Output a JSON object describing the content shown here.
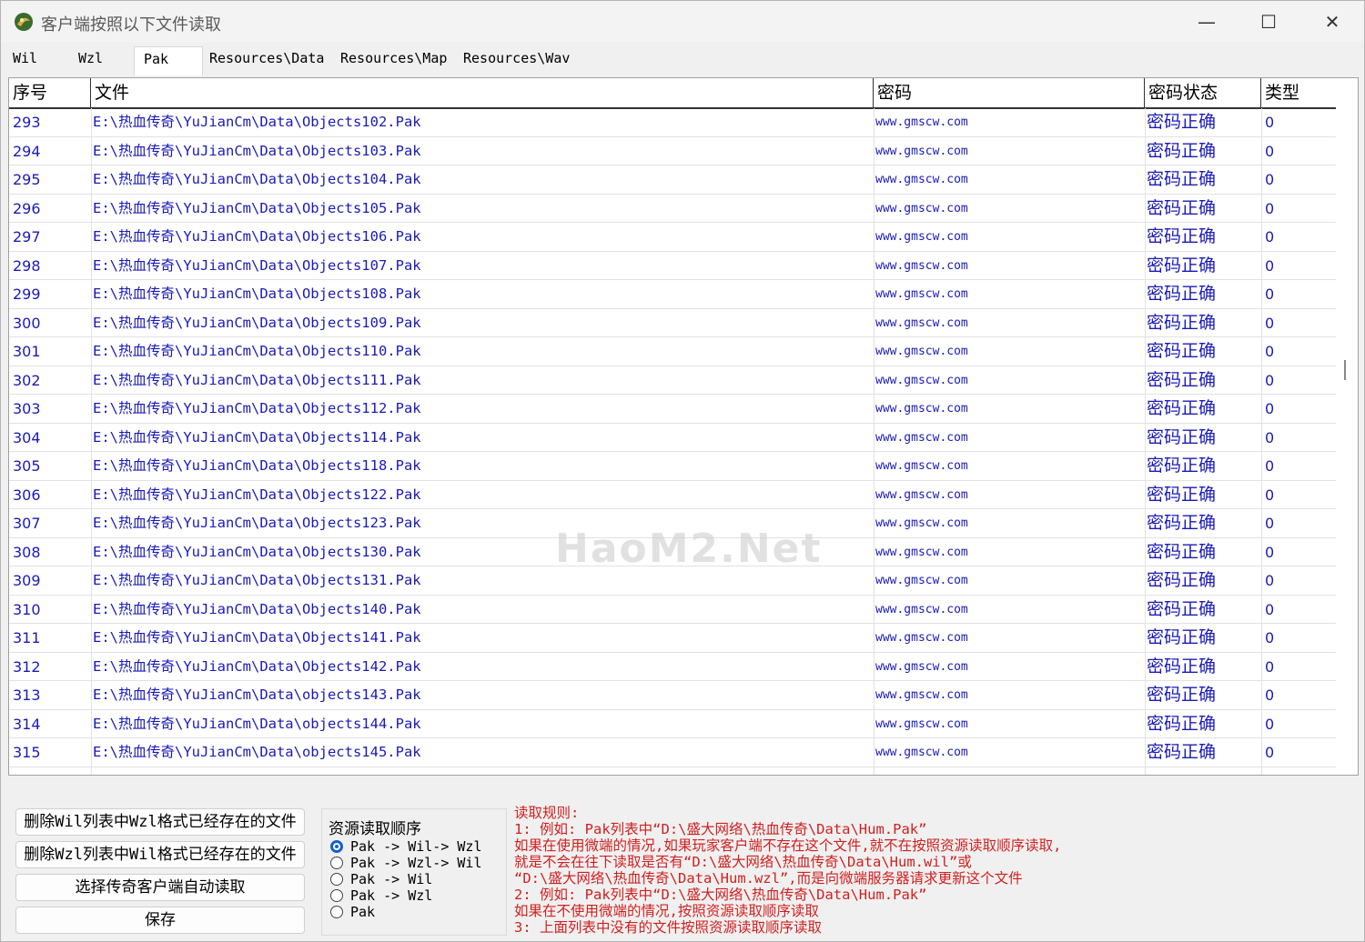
{
  "window": {
    "title": "客户端按照以下文件读取",
    "controls": {
      "minimize": "—",
      "maximize": "☐",
      "close": "✕"
    }
  },
  "tabs": [
    {
      "label": "Wil"
    },
    {
      "label": "Wzl"
    },
    {
      "label": "Pak"
    },
    {
      "label": "Resources\\Data"
    },
    {
      "label": "Resources\\Map"
    },
    {
      "label": "Resources\\Wav"
    }
  ],
  "table": {
    "columns": [
      "序号",
      "文件",
      "密码",
      "密码状态",
      "类型"
    ],
    "rows": [
      {
        "no": "293",
        "file": "E:\\热血传奇\\YuJianCm\\Data\\Objects102.Pak",
        "password": "www.gmscw.com",
        "status": "密码正确",
        "type": "0"
      },
      {
        "no": "294",
        "file": "E:\\热血传奇\\YuJianCm\\Data\\Objects103.Pak",
        "password": "www.gmscw.com",
        "status": "密码正确",
        "type": "0"
      },
      {
        "no": "295",
        "file": "E:\\热血传奇\\YuJianCm\\Data\\Objects104.Pak",
        "password": "www.gmscw.com",
        "status": "密码正确",
        "type": "0"
      },
      {
        "no": "296",
        "file": "E:\\热血传奇\\YuJianCm\\Data\\Objects105.Pak",
        "password": "www.gmscw.com",
        "status": "密码正确",
        "type": "0"
      },
      {
        "no": "297",
        "file": "E:\\热血传奇\\YuJianCm\\Data\\Objects106.Pak",
        "password": "www.gmscw.com",
        "status": "密码正确",
        "type": "0"
      },
      {
        "no": "298",
        "file": "E:\\热血传奇\\YuJianCm\\Data\\Objects107.Pak",
        "password": "www.gmscw.com",
        "status": "密码正确",
        "type": "0"
      },
      {
        "no": "299",
        "file": "E:\\热血传奇\\YuJianCm\\Data\\Objects108.Pak",
        "password": "www.gmscw.com",
        "status": "密码正确",
        "type": "0"
      },
      {
        "no": "300",
        "file": "E:\\热血传奇\\YuJianCm\\Data\\Objects109.Pak",
        "password": "www.gmscw.com",
        "status": "密码正确",
        "type": "0"
      },
      {
        "no": "301",
        "file": "E:\\热血传奇\\YuJianCm\\Data\\Objects110.Pak",
        "password": "www.gmscw.com",
        "status": "密码正确",
        "type": "0"
      },
      {
        "no": "302",
        "file": "E:\\热血传奇\\YuJianCm\\Data\\Objects111.Pak",
        "password": "www.gmscw.com",
        "status": "密码正确",
        "type": "0"
      },
      {
        "no": "303",
        "file": "E:\\热血传奇\\YuJianCm\\Data\\Objects112.Pak",
        "password": "www.gmscw.com",
        "status": "密码正确",
        "type": "0"
      },
      {
        "no": "304",
        "file": "E:\\热血传奇\\YuJianCm\\Data\\Objects114.Pak",
        "password": "www.gmscw.com",
        "status": "密码正确",
        "type": "0"
      },
      {
        "no": "305",
        "file": "E:\\热血传奇\\YuJianCm\\Data\\Objects118.Pak",
        "password": "www.gmscw.com",
        "status": "密码正确",
        "type": "0"
      },
      {
        "no": "306",
        "file": "E:\\热血传奇\\YuJianCm\\Data\\Objects122.Pak",
        "password": "www.gmscw.com",
        "status": "密码正确",
        "type": "0"
      },
      {
        "no": "307",
        "file": "E:\\热血传奇\\YuJianCm\\Data\\Objects123.Pak",
        "password": "www.gmscw.com",
        "status": "密码正确",
        "type": "0"
      },
      {
        "no": "308",
        "file": "E:\\热血传奇\\YuJianCm\\Data\\Objects130.Pak",
        "password": "www.gmscw.com",
        "status": "密码正确",
        "type": "0"
      },
      {
        "no": "309",
        "file": "E:\\热血传奇\\YuJianCm\\Data\\Objects131.Pak",
        "password": "www.gmscw.com",
        "status": "密码正确",
        "type": "0"
      },
      {
        "no": "310",
        "file": "E:\\热血传奇\\YuJianCm\\Data\\Objects140.Pak",
        "password": "www.gmscw.com",
        "status": "密码正确",
        "type": "0"
      },
      {
        "no": "311",
        "file": "E:\\热血传奇\\YuJianCm\\Data\\Objects141.Pak",
        "password": "www.gmscw.com",
        "status": "密码正确",
        "type": "0"
      },
      {
        "no": "312",
        "file": "E:\\热血传奇\\YuJianCm\\Data\\Objects142.Pak",
        "password": "www.gmscw.com",
        "status": "密码正确",
        "type": "0"
      },
      {
        "no": "313",
        "file": "E:\\热血传奇\\YuJianCm\\Data\\objects143.Pak",
        "password": "www.gmscw.com",
        "status": "密码正确",
        "type": "0"
      },
      {
        "no": "314",
        "file": "E:\\热血传奇\\YuJianCm\\Data\\objects144.Pak",
        "password": "www.gmscw.com",
        "status": "密码正确",
        "type": "0"
      },
      {
        "no": "315",
        "file": "E:\\热血传奇\\YuJianCm\\Data\\objects145.Pak",
        "password": "www.gmscw.com",
        "status": "密码正确",
        "type": "0"
      }
    ]
  },
  "buttons": {
    "delete_wzl_in_wil": "删除Wil列表中Wzl格式已经存在的文件",
    "delete_wil_in_wzl": "删除Wzl列表中Wil格式已经存在的文件",
    "auto_read": "选择传奇客户端自动读取",
    "save": "保存"
  },
  "order_group": {
    "title": "资源读取顺序",
    "options": [
      {
        "label": "Pak -> Wil-> Wzl",
        "checked": true
      },
      {
        "label": "Pak -> Wzl-> Wil",
        "checked": false
      },
      {
        "label": "Pak -> Wil",
        "checked": false
      },
      {
        "label": "Pak -> Wzl",
        "checked": false
      },
      {
        "label": "Pak",
        "checked": false
      }
    ]
  },
  "rules": {
    "title": "读取规则:",
    "lines": [
      "1: 例如: Pak列表中“D:\\盛大网络\\热血传奇\\Data\\Hum.Pak”",
      "   如果在使用微端的情况,如果玩家客户端不存在这个文件,就不在按照资源读取顺序读取,",
      "   就是不会在往下读取是否有“D:\\盛大网络\\热血传奇\\Data\\Hum.wil”或",
      "  “D:\\盛大网络\\热血传奇\\Data\\Hum.wzl”,而是向微端服务器请求更新这个文件",
      "2: 例如: Pak列表中“D:\\盛大网络\\热血传奇\\Data\\Hum.Pak”",
      "   如果在不使用微端的情况,按照资源读取顺序读取",
      "3: 上面列表中没有的文件按照资源读取顺序读取"
    ]
  },
  "watermark": "HaoM2.Net",
  "colors": {
    "link_blue": "#1a1ab8",
    "rules_red": "#d02020",
    "radio_blue": "#1562c9"
  }
}
